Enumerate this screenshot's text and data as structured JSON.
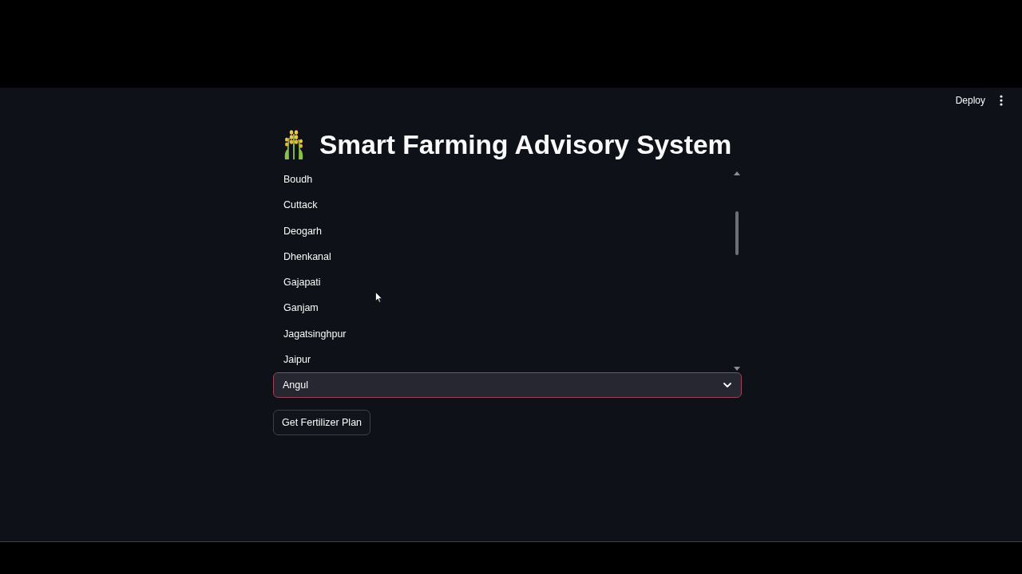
{
  "header": {
    "deploy": "Deploy"
  },
  "title": {
    "text": "Smart Farming Advisory System"
  },
  "dropdown": {
    "options": [
      {
        "label": "Boudh",
        "selected": false
      },
      {
        "label": "Cuttack",
        "selected": false
      },
      {
        "label": "Deogarh",
        "selected": false
      },
      {
        "label": "Dhenkanal",
        "selected": false
      },
      {
        "label": "Gajapati",
        "selected": false
      },
      {
        "label": "Ganjam",
        "selected": false
      },
      {
        "label": "Jagatsinghpur",
        "selected": false
      },
      {
        "label": "Jaipur",
        "selected": false
      }
    ]
  },
  "select": {
    "value": "Angul"
  },
  "button": {
    "label": "Get Fertilizer Plan"
  }
}
